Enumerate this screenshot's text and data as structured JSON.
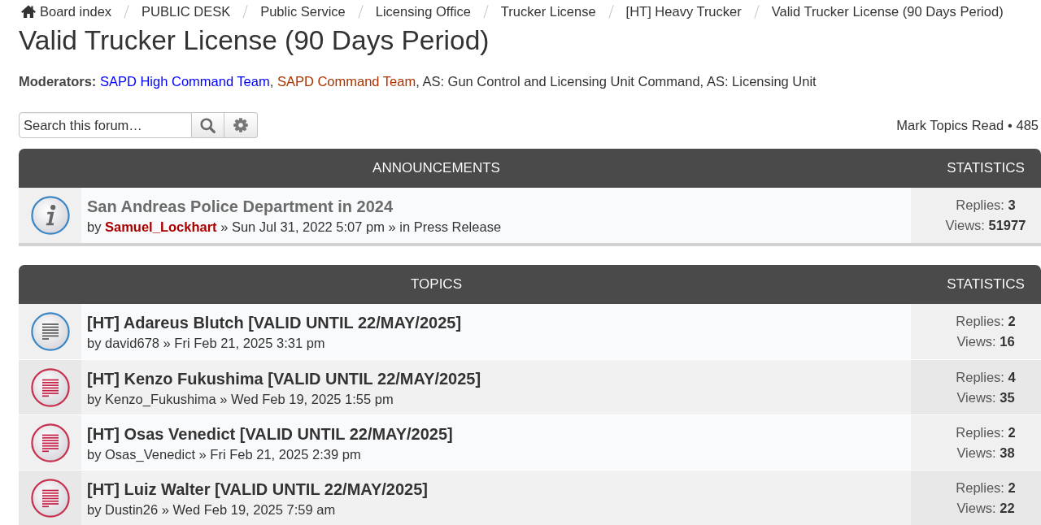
{
  "breadcrumbs": [
    {
      "kind": "home",
      "label": "Board index"
    },
    {
      "kind": "link",
      "label": "PUBLIC DESK"
    },
    {
      "kind": "link",
      "label": "Public Service"
    },
    {
      "kind": "link",
      "label": "Licensing Office"
    },
    {
      "kind": "link",
      "label": "Trucker License"
    },
    {
      "kind": "link",
      "label": "[HT] Heavy Trucker"
    },
    {
      "kind": "link",
      "label": "Valid Trucker License (90 Days Period)"
    }
  ],
  "forum_title": "Valid Trucker License (90 Days Period)",
  "moderators": {
    "label": "Moderators:",
    "separator": ",",
    "groups": [
      {
        "name": "SAPD High Command Team",
        "color": "#0000ff"
      },
      {
        "name": "SAPD Command Team",
        "color": "#aa3300"
      },
      {
        "name": "AS: Gun Control and Licensing Unit Command",
        "color": "#333333"
      },
      {
        "name": "AS: Licensing Unit",
        "color": "#333333"
      }
    ]
  },
  "search": {
    "placeholder": "Search this forum…"
  },
  "action_bar": {
    "mark_read": "Mark Topics Read",
    "topic_count": "• 485"
  },
  "sections": [
    {
      "heading": "ANNOUNCEMENTS",
      "stats_heading": "STATISTICS",
      "topics": [
        {
          "kind": "announcement",
          "unread": false,
          "title": "San Andreas Police Department in 2024",
          "by_label": "by",
          "author": {
            "name": "Samuel_Lockhart",
            "color": "#aa0000"
          },
          "posted": "» Sun Jul 31, 2022 5:07 pm",
          "in_label": "» in",
          "forum": "Press Release",
          "replies": "Replies: **3**",
          "views": "Views: **51977**"
        }
      ]
    },
    {
      "heading": "TOPICS",
      "stats_heading": "STATISTICS",
      "topics": [
        {
          "kind": "topic",
          "unread": false,
          "title": "[HT] Adareus Blutch [VALID UNTIL 22/MAY/2025]",
          "by_label": "by",
          "author": {
            "name": "david678"
          },
          "posted": "» Fri Feb 21, 2025 3:31 pm",
          "replies": "Replies: **2**",
          "views": "Views: **16**"
        },
        {
          "kind": "topic",
          "unread": true,
          "title": "[HT] Kenzo Fukushima [VALID UNTIL 22/MAY/2025]",
          "by_label": "by",
          "author": {
            "name": "Kenzo_Fukushima"
          },
          "posted": "» Wed Feb 19, 2025 1:55 pm",
          "replies": "Replies: **4**",
          "views": "Views: **35**"
        },
        {
          "kind": "topic",
          "unread": true,
          "title": "[HT] Osas Venedict [VALID UNTIL 22/MAY/2025]",
          "by_label": "by",
          "author": {
            "name": "Osas_Venedict"
          },
          "posted": "» Fri Feb 21, 2025 2:39 pm",
          "replies": "Replies: **2**",
          "views": "Views: **38**"
        },
        {
          "kind": "topic",
          "unread": true,
          "title": "[HT] Luiz Walter [VALID UNTIL 22/MAY/2025]",
          "by_label": "by",
          "author": {
            "name": "Dustin26"
          },
          "posted": "» Wed Feb 19, 2025 7:59 am",
          "replies": "Replies: **2**",
          "views": "Views: **22**"
        }
      ]
    }
  ]
}
